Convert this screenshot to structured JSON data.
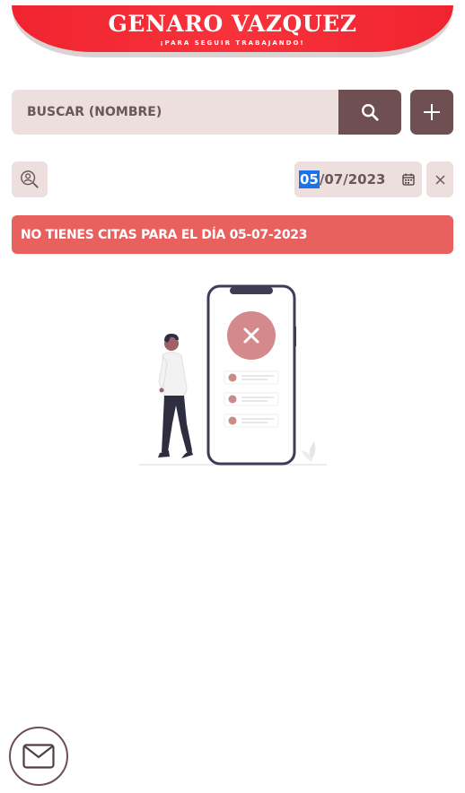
{
  "header": {
    "title": "GENARO VAZQUEZ",
    "subtitle": "¡PARA SEGUIR TRABAJANDO!"
  },
  "search": {
    "placeholder": "BUSCAR (NOMBRE)",
    "value": "",
    "button_icon": "search-icon"
  },
  "toolbar": {
    "add_icon": "plus-icon",
    "user_search_icon": "user-search-icon"
  },
  "date_filter": {
    "day": "05",
    "rest": "/07/2023",
    "calendar_icon": "calendar-icon",
    "clear_icon": "close-icon"
  },
  "alert": {
    "message": "NO TIENES CITAS PARA EL DÍA 05-07-2023"
  },
  "colors": {
    "brand_red": "#f8323b",
    "accent_brown": "#6f4f51",
    "input_bg": "#eedfdf",
    "alert_bg": "#e8615f"
  },
  "footer": {
    "mail_icon": "mail-icon"
  }
}
